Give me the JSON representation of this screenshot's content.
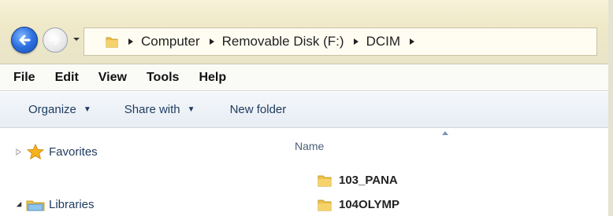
{
  "address_bar": {
    "crumbs": [
      "Computer",
      "Removable Disk (F:)",
      "DCIM"
    ]
  },
  "menu_bar": {
    "items": [
      "File",
      "Edit",
      "View",
      "Tools",
      "Help"
    ]
  },
  "command_bar": {
    "organize": "Organize",
    "share_with": "Share with",
    "new_folder": "New folder"
  },
  "navigation": {
    "favorites": "Favorites",
    "libraries": "Libraries"
  },
  "file_list": {
    "column_name": "Name",
    "items": [
      "103_PANA",
      "104OLYMP"
    ]
  },
  "colors": {
    "folder": "#f0c24b",
    "back_button": "#2d6fe0",
    "link_text": "#1e3a5e"
  },
  "icons": {
    "back": "back-arrow-icon",
    "forward": "forward-arrow-icon",
    "folder": "folder-icon",
    "favorites": "star-icon",
    "libraries": "library-icon"
  }
}
